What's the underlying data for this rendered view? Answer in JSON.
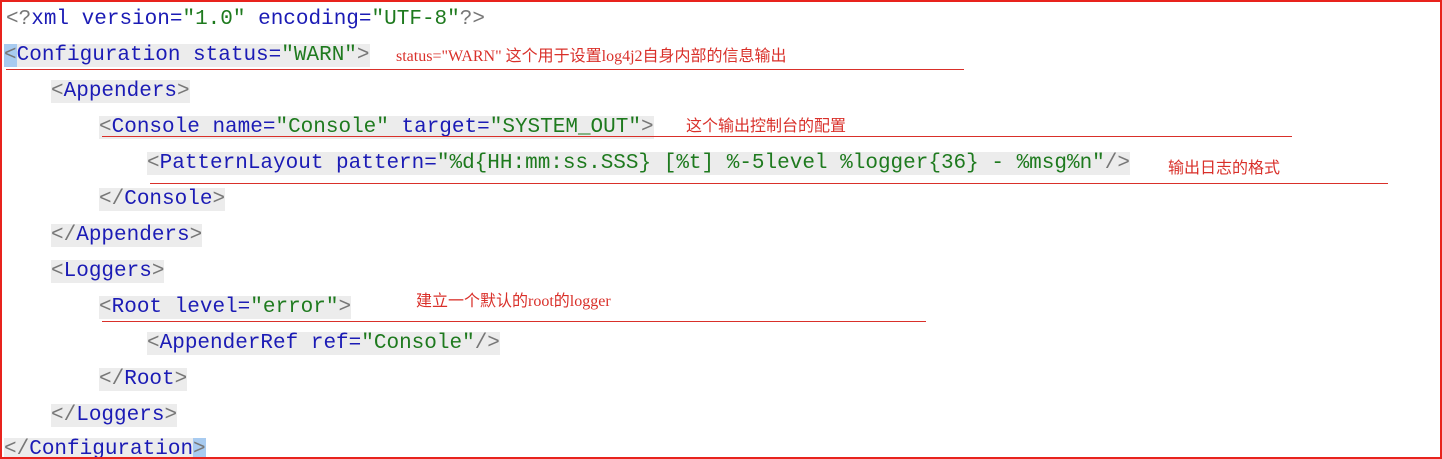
{
  "xml_decl": {
    "open": "<?",
    "name": "xml",
    "attrs": [
      {
        "name": "version",
        "value": "\"1.0\""
      },
      {
        "name": "encoding",
        "value": "\"UTF-8\""
      }
    ],
    "close": "?>"
  },
  "lines": {
    "configuration_open": {
      "tag": "Configuration",
      "attr": "status",
      "value": "\"WARN\""
    },
    "appenders_open": {
      "tag": "Appenders"
    },
    "console_open": {
      "tag": "Console",
      "attr1": "name",
      "val1": "\"Console\"",
      "attr2": "target",
      "val2": "\"SYSTEM_OUT\""
    },
    "pattern_layout": {
      "tag": "PatternLayout",
      "attr": "pattern",
      "value": "\"%d{HH:mm:ss.SSS} [%t] %-5level %logger{36} - %msg%n\""
    },
    "console_close": {
      "tag": "Console"
    },
    "appenders_close": {
      "tag": "Appenders"
    },
    "loggers_open": {
      "tag": "Loggers"
    },
    "root_open": {
      "tag": "Root",
      "attr": "level",
      "value": "\"error\""
    },
    "appender_ref": {
      "tag": "AppenderRef",
      "attr": "ref",
      "value": "\"Console\""
    },
    "root_close": {
      "tag": "Root"
    },
    "loggers_close": {
      "tag": "Loggers"
    },
    "configuration_close": {
      "tag": "Configuration"
    }
  },
  "annotations": {
    "status_note": "status=\"WARN\" 这个用于设置log4j2自身内部的信息输出",
    "console_note": "这个输出控制台的配置",
    "pattern_note": "输出日志的格式",
    "root_note": "建立一个默认的root的logger"
  },
  "colors": {
    "tag": "#1b1bb5",
    "value": "#1e7a1e",
    "bracket": "#777777",
    "annotation": "#d9302a",
    "border": "#e8231d",
    "line_highlight": "#ececec",
    "caret_highlight": "#a8cbf0"
  }
}
